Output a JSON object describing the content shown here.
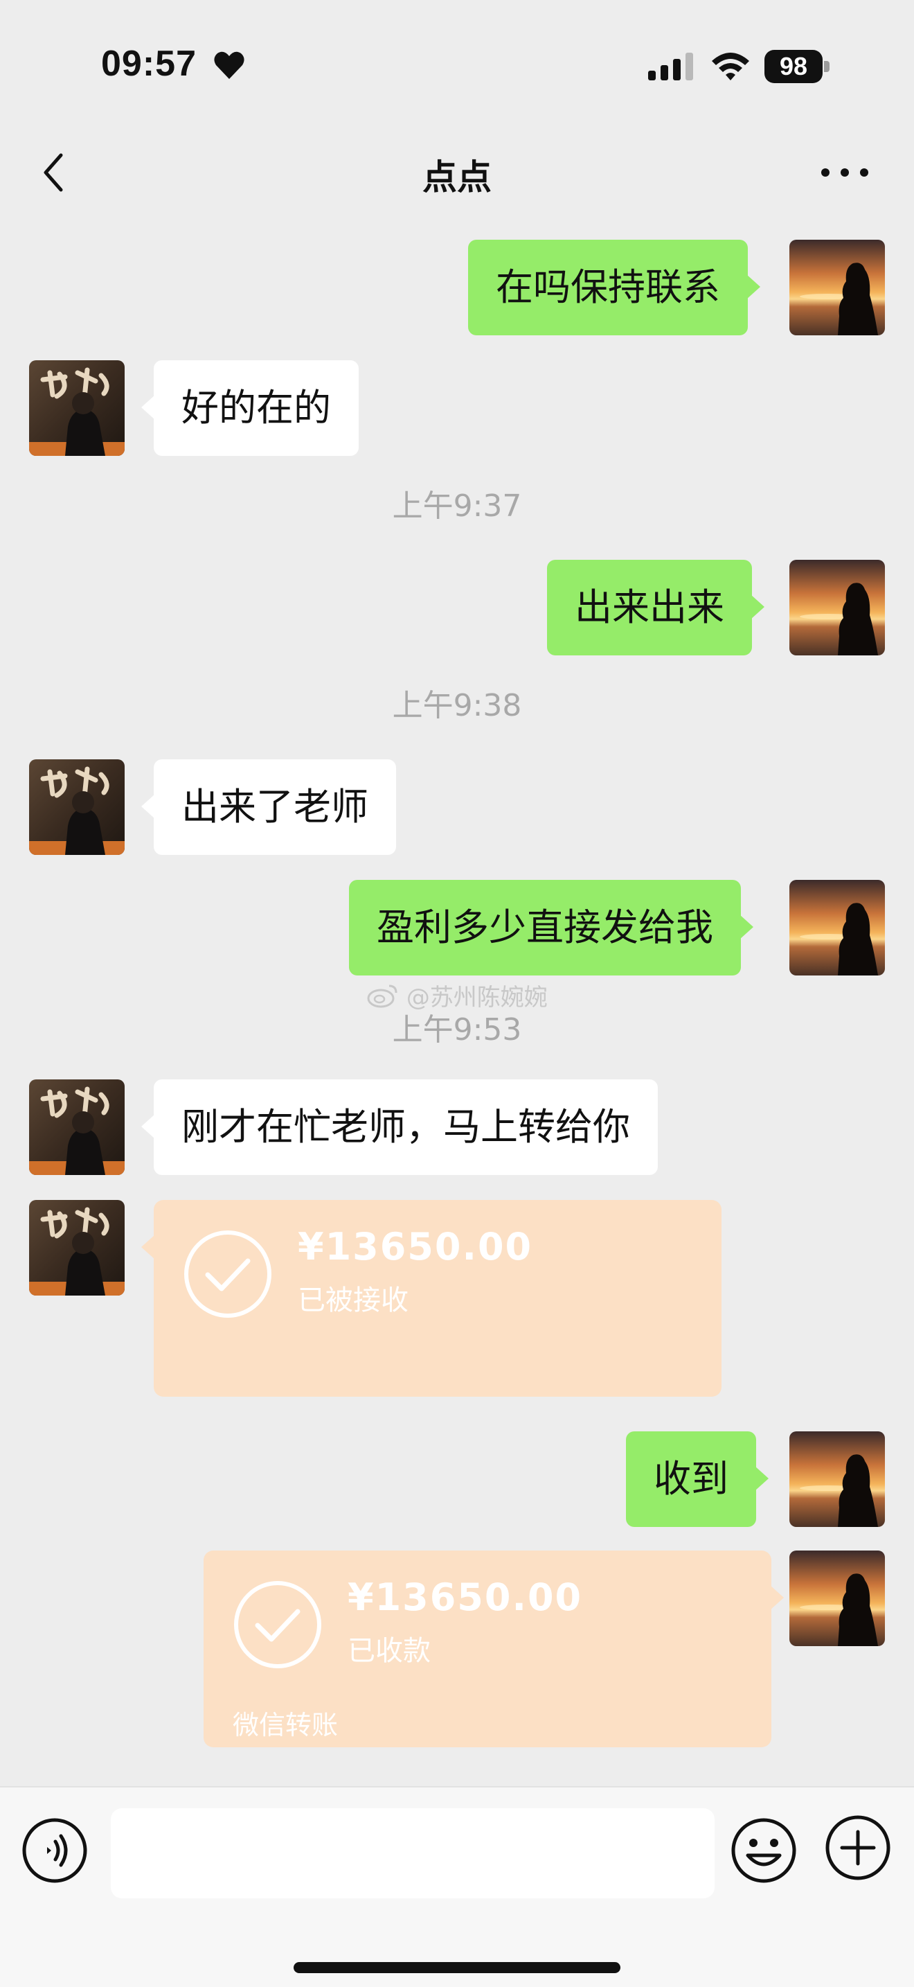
{
  "status_bar": {
    "time": "09:57",
    "battery": "98",
    "icons": [
      "heart-icon",
      "signal-icon",
      "wifi-icon",
      "battery-icon"
    ]
  },
  "nav": {
    "title": "点点",
    "icons": [
      "back-arrow-icon",
      "more-dots-icon"
    ]
  },
  "messages": [
    {
      "side": "right",
      "text": "在吗保持联系"
    },
    {
      "side": "left",
      "text": "好的在的"
    },
    {
      "type": "time",
      "text": "上午9:37"
    },
    {
      "side": "right",
      "text": "出来出来"
    },
    {
      "type": "time",
      "text": "上午9:38"
    },
    {
      "side": "left",
      "text": "出来了老师"
    },
    {
      "side": "right",
      "text": "盈利多少直接发给我"
    },
    {
      "type": "time",
      "text": "上午9:53"
    },
    {
      "side": "left",
      "text": "刚才在忙老师，马上转给你"
    },
    {
      "side": "left",
      "type": "transfer",
      "amount": "¥13650.00",
      "status": "已被接收"
    },
    {
      "side": "right",
      "text": "收到"
    },
    {
      "side": "right",
      "type": "transfer",
      "amount": "¥13650.00",
      "status": "已收款",
      "footer": "微信转账"
    }
  ],
  "watermark": {
    "text": "@苏州陈婉婉",
    "icon": "weibo-logo-icon"
  },
  "input_bar": {
    "placeholder": "",
    "icons": [
      "voice-icon",
      "emoji-icon",
      "plus-icon"
    ]
  },
  "colors": {
    "background": "#ededed",
    "sent_bubble": "#95ec69",
    "received_bubble": "#ffffff",
    "transfer_card": "#fce0c5",
    "timestamp": "#a8a8a8"
  }
}
